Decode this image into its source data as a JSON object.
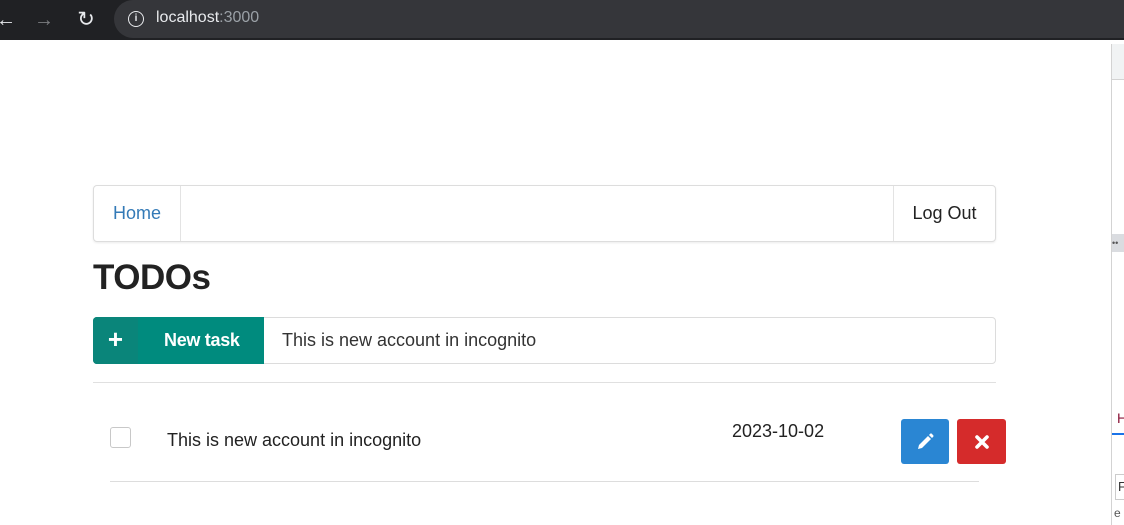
{
  "browser": {
    "url_host": "localhost",
    "url_port": ":3000",
    "icons": {
      "back": "arrow-left-icon",
      "forward": "arrow-right-icon",
      "reload": "reload-icon",
      "info": "info-icon"
    }
  },
  "navbar": {
    "home_label": "Home",
    "logout_label": "Log Out"
  },
  "page": {
    "title": "TODOs"
  },
  "new_task": {
    "button_label": "New task",
    "input_value": "This is new account in incognito",
    "colors": {
      "button": "#008b7e"
    }
  },
  "todos": [
    {
      "text": "This is new account in incognito",
      "date": "2023-10-02",
      "completed": false
    }
  ],
  "colors": {
    "link": "#337ab7",
    "edit": "#2a86d3",
    "delete": "#d52b2b"
  },
  "devtools": {
    "letter_h": "H",
    "letter_f": "F",
    "letter_e": "e"
  }
}
